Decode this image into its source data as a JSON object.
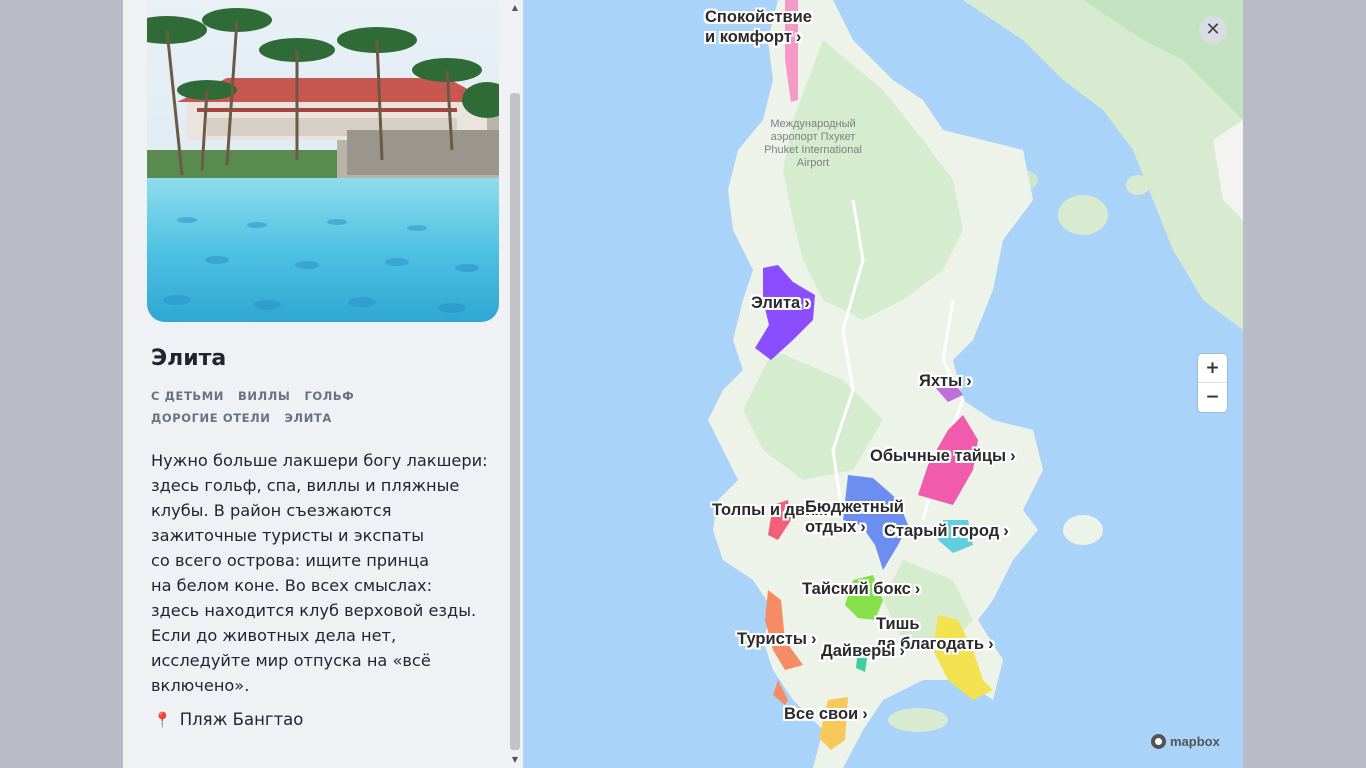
{
  "district": {
    "title": "Элита",
    "tags": [
      "С детьми",
      "Виллы",
      "Гольф",
      "Дорогие отели",
      "Элита"
    ],
    "description": "Нужно больше лакшери богу лакшери:\nздесь гольф, спа, виллы и пляжные\nклубы. В район съезжаются\nзажиточные туристы и экспаты\nсо всего острова: ищите принца\nна белом коне. Во всех смыслах:\nздесь находится клуб верховой езды.\nЕсли до животных дела нет,\nисследуйте мир отпуска на «всё\nвключено».",
    "location_icon": "pin-icon",
    "location": "Пляж Бангтао"
  },
  "map": {
    "airport_label": "Международный\nаэропорт Пхукет\nPhuket International\nAirport",
    "zoom_in": "+",
    "zoom_out": "−",
    "close": "✕",
    "attribution": "mapbox",
    "chevron": "›",
    "districts": [
      {
        "name": "Спокойствие\nи комфорт",
        "color": "#f59ac6"
      },
      {
        "name": "Элита",
        "color": "#8a4dff"
      },
      {
        "name": "Яхты",
        "color": "#c06ed9"
      },
      {
        "name": "Обычные тайцы",
        "color": "#f05cab"
      },
      {
        "name": "Толпы и движ",
        "color": "#f26078"
      },
      {
        "name": "Бюджетный\nотдых",
        "color": "#6b8ef0"
      },
      {
        "name": "Старый город",
        "color": "#5fcfe0"
      },
      {
        "name": "Тайский бокс",
        "color": "#86e04a"
      },
      {
        "name": "Туристы",
        "color": "#f68c66"
      },
      {
        "name": "Тишь\nда благодать",
        "color": "#f2e24f"
      },
      {
        "name": "Дайверы",
        "color": "#3ecf9a"
      },
      {
        "name": "Все свои",
        "color": "#f7c85a"
      }
    ]
  }
}
